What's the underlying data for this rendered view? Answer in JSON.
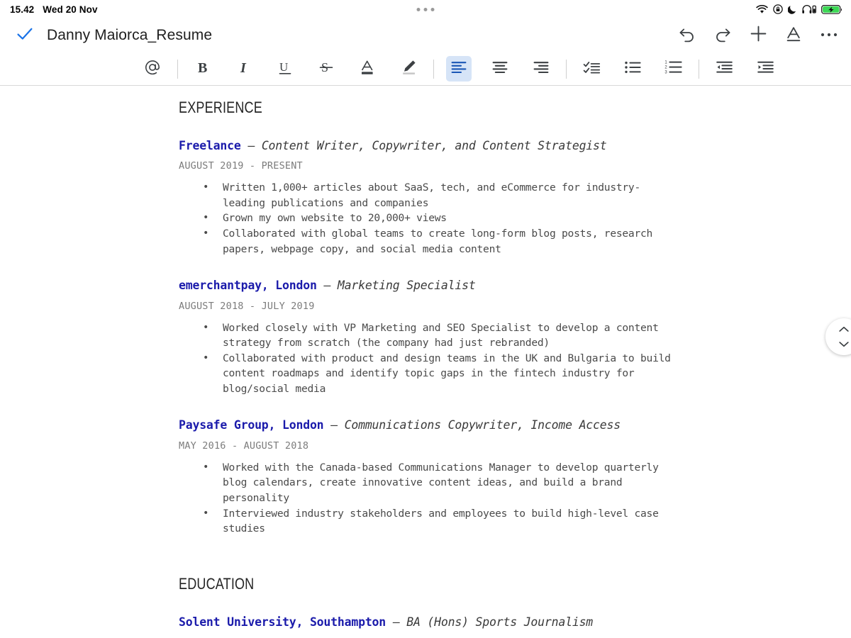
{
  "status_bar": {
    "time": "15.42",
    "date": "Wed 20 Nov",
    "icons": [
      "wifi-icon",
      "rotation-lock-icon",
      "moon-icon",
      "headphones-battery-icon",
      "battery-charging-icon"
    ],
    "battery_color": "#3cd855"
  },
  "doc_header": {
    "check_label": "check-icon",
    "title": "Danny Maiorca_Resume",
    "actions": [
      {
        "name": "undo-button",
        "label": "Undo"
      },
      {
        "name": "redo-button",
        "label": "Redo"
      },
      {
        "name": "insert-button",
        "label": "Insert"
      },
      {
        "name": "text-format-button",
        "label": "Format text"
      },
      {
        "name": "more-options-button",
        "label": "More options"
      }
    ]
  },
  "format_toolbar": {
    "accent": "#d6e4f7",
    "items": [
      {
        "name": "mention-button",
        "label": "Mention",
        "active": false
      },
      {
        "name": "bold-button",
        "label": "Bold",
        "active": false
      },
      {
        "name": "italic-button",
        "label": "Italic",
        "active": false
      },
      {
        "name": "underline-button",
        "label": "Underline",
        "active": false
      },
      {
        "name": "strikethrough-button",
        "label": "Strikethrough",
        "active": false
      },
      {
        "name": "text-color-button",
        "label": "Text color",
        "active": false
      },
      {
        "name": "highlight-button",
        "label": "Highlight",
        "active": false
      },
      {
        "name": "align-left-button",
        "label": "Align left",
        "active": true
      },
      {
        "name": "align-center-button",
        "label": "Align center",
        "active": false
      },
      {
        "name": "align-right-button",
        "label": "Align right",
        "active": false
      },
      {
        "name": "checklist-button",
        "label": "Checklist",
        "active": false
      },
      {
        "name": "bulleted-list-button",
        "label": "Bulleted list",
        "active": false
      },
      {
        "name": "numbered-list-button",
        "label": "Numbered list",
        "active": false
      },
      {
        "name": "outdent-button",
        "label": "Decrease indent",
        "active": false
      },
      {
        "name": "indent-button",
        "label": "Increase indent",
        "active": false
      }
    ]
  },
  "document": {
    "link_color": "#1b1bab",
    "experience_heading": "EXPERIENCE",
    "education_heading": "EDUCATION",
    "experience": [
      {
        "org": "Freelance",
        "dash": " — ",
        "role": "Content Writer, Copywriter, and Content Strategist",
        "dates": "AUGUST 2019 - PRESENT",
        "bullets": [
          "Written 1,000+ articles about SaaS, tech, and eCommerce for industry-leading publications and companies",
          "Grown my own website to 20,000+ views",
          "Collaborated with global teams to create long-form blog posts, research papers, webpage copy, and social media content"
        ]
      },
      {
        "org": "emerchantpay, London",
        "dash": " — ",
        "role": "Marketing Specialist",
        "dates": "AUGUST 2018 - JULY 2019",
        "bullets": [
          "Worked closely with VP Marketing and SEO Specialist to develop a content strategy from scratch (the company had just rebranded)",
          "Collaborated with product and design teams in the UK and Bulgaria to build content roadmaps and identify topic gaps in the fintech industry for blog/social media"
        ]
      },
      {
        "org": "Paysafe Group, London",
        "dash": " — ",
        "role": "Communications Copywriter, Income Access",
        "dates": "MAY 2016 - AUGUST 2018",
        "bullets": [
          "Worked with the Canada-based Communications Manager to develop quarterly blog calendars, create innovative content ideas, and build a brand personality",
          "Interviewed industry stakeholders and employees to build high-level case studies"
        ]
      }
    ],
    "education": [
      {
        "org": "Solent University, Southampton",
        "dash": " — ",
        "role": "BA (Hons) Sports Journalism"
      }
    ]
  },
  "scroll_handle": {
    "label": "scroll-handle"
  }
}
